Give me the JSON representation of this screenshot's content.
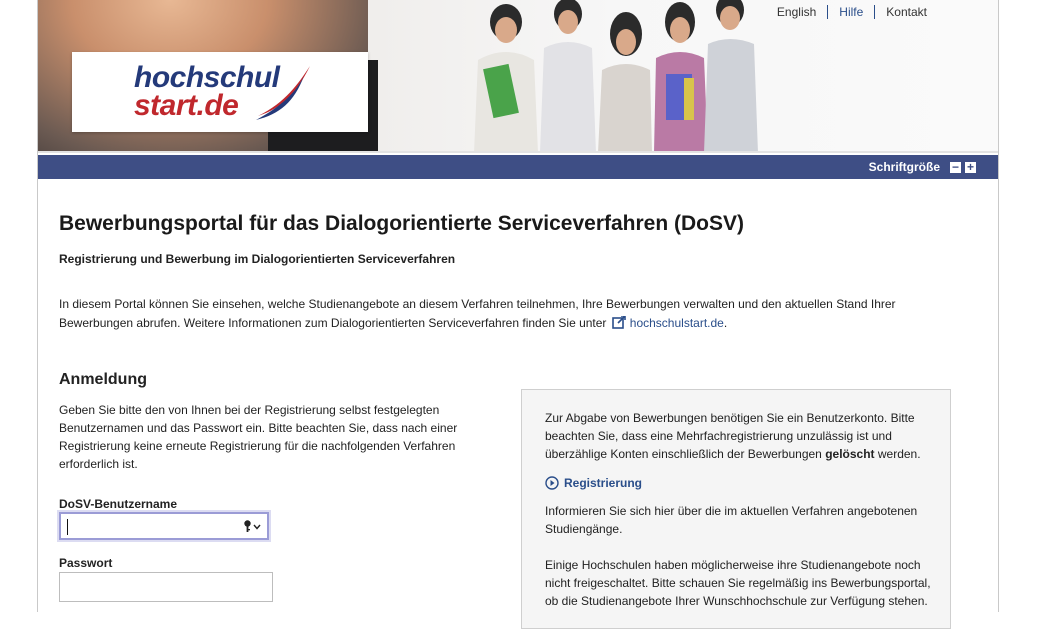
{
  "brand": {
    "logo_line1": "hochschul",
    "logo_line2": "start.de"
  },
  "topnav": {
    "english": "English",
    "help": "Hilfe",
    "contact": "Kontakt"
  },
  "fontsize": {
    "label": "Schriftgröße",
    "decrease": "−",
    "increase": "+"
  },
  "page": {
    "title": "Bewerbungsportal für das Dialogorientierte Serviceverfahren (DoSV)",
    "subtitle": "Registrierung und Bewerbung im Dialogorientierten Serviceverfahren",
    "intro_text": "In diesem Portal können Sie einsehen, welche Studienangebote an diesem Verfahren teilnehmen, Ihre Bewerbungen verwalten und den aktuellen Stand Ihrer Bewerbungen abrufen. Weitere Informationen zum Dialogorientierten Serviceverfahren finden Sie unter",
    "intro_link": "hochschulstart.de",
    "intro_end": "."
  },
  "login": {
    "heading": "Anmeldung",
    "text": "Geben Sie bitte den von Ihnen bei der Registrierung selbst festgelegten Benutzernamen und das Passwort ein. Bitte beachten Sie, dass nach einer Registrierung keine erneute Registrierung für die nachfolgenden Verfahren erforderlich ist.",
    "username_label": "DoSV-Benutzername",
    "username_value": "",
    "password_label": "Passwort",
    "password_value": ""
  },
  "infobox": {
    "p1_text": "Zur Abgabe von Bewerbungen benötigen Sie ein Benutzerkonto. Bitte beachten Sie, dass eine Mehrfachregistrierung unzulässig ist und überzählige Konten einschließlich der Bewerbungen",
    "p1_bold": "gelöscht",
    "p1_end": " werden.",
    "register_link": "Registrierung",
    "p2": "Informieren Sie sich hier über die im aktuellen Verfahren angebotenen Studiengänge.",
    "p3": "Einige Hochschulen haben möglicherweise ihre Studienangebote noch nicht freigeschaltet. Bitte schauen Sie regelmäßig ins Bewerbungsportal, ob die Studienangebote Ihrer Wunschhochschule zur Verfügung stehen."
  },
  "colors": {
    "bar": "#3e4e85",
    "link": "#2a4e8a",
    "logo_blue": "#243a7a",
    "logo_red": "#c0282d"
  }
}
